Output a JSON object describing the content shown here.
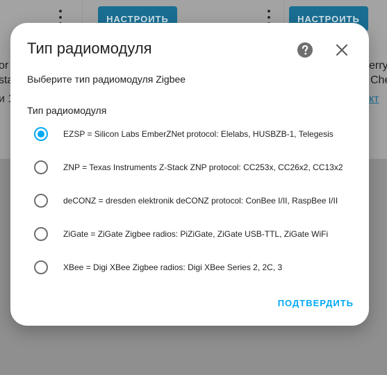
{
  "background": {
    "configure_label": "НАСТРОИТЬ",
    "left_fragments": [
      "or",
      "sta",
      "и 1"
    ],
    "right_fragments": [
      "erry",
      "Che",
      "кт"
    ]
  },
  "dialog": {
    "title": "Тип радиомодуля",
    "subtitle": "Выберите тип радиомодуля Zigbee",
    "group_label": "Тип радиомодуля",
    "options": [
      {
        "label": "EZSP = Silicon Labs EmberZNet protocol: Elelabs, HUSBZB-1, Telegesis",
        "selected": true
      },
      {
        "label": "ZNP = Texas Instruments Z-Stack ZNP protocol: CC253x, CC26x2, CC13x2",
        "selected": false
      },
      {
        "label": "deCONZ = dresden elektronik deCONZ protocol: ConBee I/II, RaspBee I/II",
        "selected": false
      },
      {
        "label": "ZiGate = ZiGate Zigbee radios: PiZiGate, ZiGate USB-TTL, ZiGate WiFi",
        "selected": false
      },
      {
        "label": "XBee = Digi XBee Zigbee radios: Digi XBee Series 2, 2C, 3",
        "selected": false
      }
    ],
    "confirm_label": "ПОДТВЕРДИТЬ",
    "icons": {
      "help": "help-circle-icon",
      "close": "close-icon"
    }
  },
  "colors": {
    "accent": "#03a9f4",
    "scrim": "#8f8f8f",
    "dimmed_button": "#1a6e92"
  }
}
